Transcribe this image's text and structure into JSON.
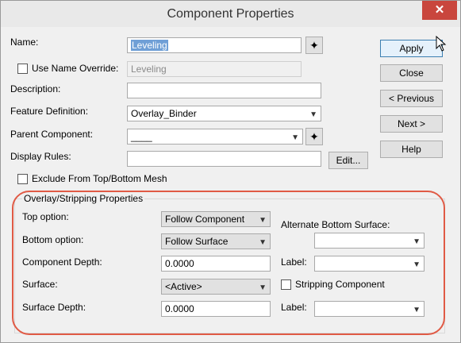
{
  "window": {
    "title": "Component Properties",
    "close_glyph": "✕"
  },
  "fields": {
    "name_label": "Name:",
    "name_value": "Leveling",
    "use_override_label": "Use Name Override:",
    "override_value": "Leveling",
    "description_label": "Description:",
    "description_value": "",
    "feature_def_label": "Feature Definition:",
    "feature_def_value": "Overlay_Binder",
    "parent_label": "Parent Component:",
    "parent_value": "____",
    "display_rules_label": "Display Rules:",
    "edit_label": "Edit...",
    "exclude_label": "Exclude From Top/Bottom Mesh"
  },
  "buttons": {
    "apply": "Apply",
    "close": "Close",
    "previous": "< Previous",
    "next": "Next >",
    "help": "Help"
  },
  "group": {
    "caption": "Overlay/Stripping Properties",
    "top_option_label": "Top option:",
    "top_option_value": "Follow Component",
    "bottom_option_label": "Bottom option:",
    "bottom_option_value": "Follow Surface",
    "component_depth_label": "Component Depth:",
    "component_depth_value": "0.0000",
    "surface_label": "Surface:",
    "surface_value": "<Active>",
    "surface_depth_label": "Surface Depth:",
    "surface_depth_value": "0.0000",
    "alt_bottom_label": "Alternate Bottom Surface:",
    "alt_bottom_value": "",
    "label1_label": "Label:",
    "label1_value": "",
    "stripping_label": "Stripping Component",
    "label2_label": "Label:",
    "label2_value": ""
  },
  "icons": {
    "pick": "pick-element-icon",
    "dropdown": "chevron-down-icon"
  },
  "colors": {
    "highlight": "#e05a45",
    "selection": "#6f9fd6",
    "close_button": "#c9463d"
  }
}
